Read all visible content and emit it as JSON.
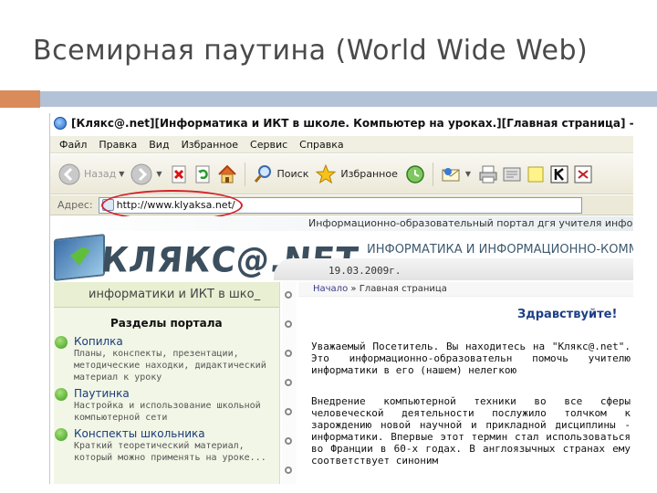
{
  "slide": {
    "title": "Всемирная паутина (World Wide Web)"
  },
  "browser": {
    "window_title": "[Клякс@.net][Информатика и ИКТ в школе. Компьютер на уроках.][Главная страница] - Microsoft",
    "menu": [
      "Файл",
      "Правка",
      "Вид",
      "Избранное",
      "Сервис",
      "Справка"
    ],
    "toolbar": {
      "back_label": "Назад",
      "search_label": "Поиск",
      "favorites_label": "Избранное"
    },
    "address": {
      "label": "Адрес:",
      "url": "http://www.klyaksa.net/"
    },
    "annotation_color": "#d2232a"
  },
  "page": {
    "portal_desc": "Информационно-образовательный портал дгя учителя инфо",
    "logo_text": "КЛЯКС@.NET",
    "site_heading": "ИНФОРМАТИКА И ИНФОРМАЦИОННО-КОММУ",
    "date": "19.03.2009г.",
    "left_header": "информатики и ИКТ в шко_",
    "sections_title": "Разделы портала",
    "nav_items": [
      {
        "title": "Копилка",
        "desc": "Планы, конспекты, презентации, методические находки, дидактический материал к уроку"
      },
      {
        "title": "Паутинка",
        "desc": "Настройка и использование школьной компьютерной сети"
      },
      {
        "title": "Конспекты школьника",
        "desc": "Краткий теоретический материал, который можно применять на уроке..."
      }
    ],
    "breadcrumb_home": "Начало",
    "breadcrumb_sep": "»",
    "breadcrumb_current": "Главная страница",
    "greeting": "Здравствуйте!",
    "para1": "Уважаемый Посетитель. Вы находитесь на \"Клякс@.net\". Это информационно-образовательн помочь учителю информатики в его (нашем) нелегкою",
    "para2": "Внедрение компьютерной техники во все сферы человеческой деятельности послужило толчком к зарождению новой научной и прикладной дисциплины - информатики. Впервые этот термин стал использоваться во Франции в 60-х годах. В англоязычных странах ему соответствует синоним"
  }
}
